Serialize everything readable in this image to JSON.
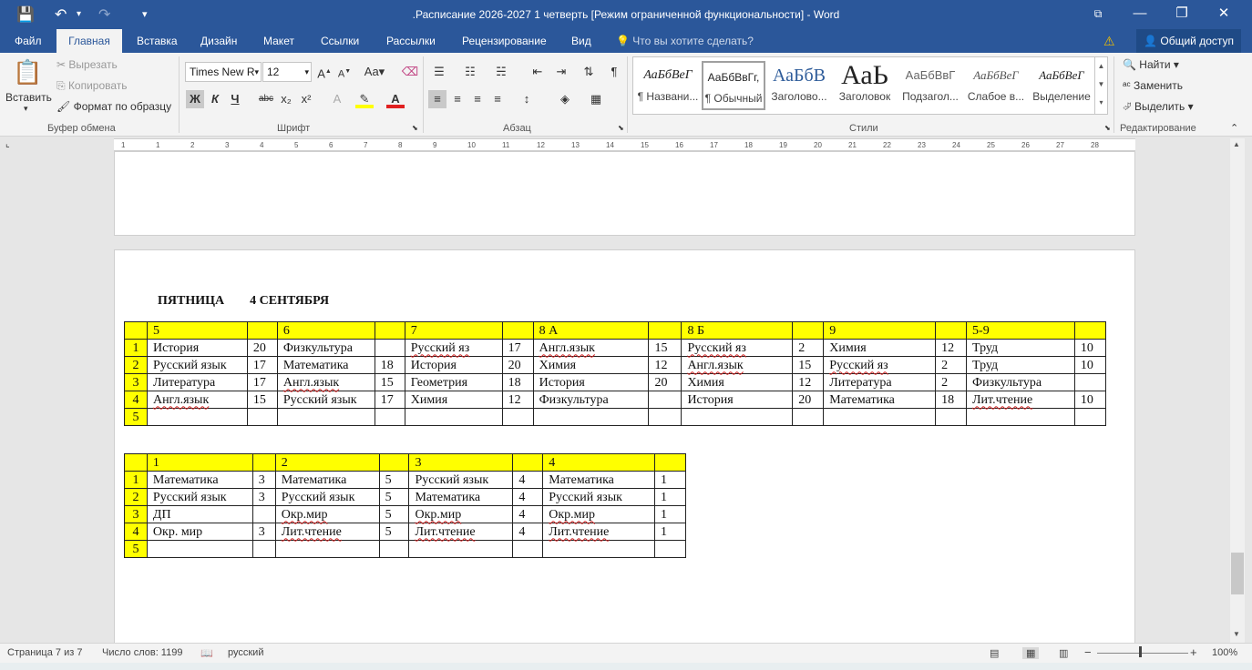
{
  "window": {
    "title": ".Расписание 2026-2027 1 четверть [Режим ограниченной функциональности] - Word",
    "minimize": "—",
    "restore": "❐",
    "close": "✕",
    "ribbon_display": "⧉"
  },
  "tabs": [
    {
      "label": "Файл",
      "active": false
    },
    {
      "label": "Главная",
      "active": true
    },
    {
      "label": "Вставка",
      "active": false
    },
    {
      "label": "Дизайн",
      "active": false
    },
    {
      "label": "Макет",
      "active": false
    },
    {
      "label": "Ссылки",
      "active": false
    },
    {
      "label": "Рассылки",
      "active": false
    },
    {
      "label": "Рецензирование",
      "active": false
    },
    {
      "label": "Вид",
      "active": false
    }
  ],
  "tell_me": "Что вы хотите сделать?",
  "share": "Общий доступ",
  "clipboard": {
    "paste": "Вставить",
    "cut": "Вырезать",
    "copy": "Копировать",
    "format_painter": "Формат по образцу",
    "label": "Буфер обмена"
  },
  "font": {
    "name": "Times New R",
    "size": "12",
    "label": "Шрифт",
    "bold": "Ж",
    "italic": "К",
    "underline": "Ч",
    "strike": "abc",
    "subscript": "x₂",
    "superscript": "x²"
  },
  "paragraph": {
    "label": "Абзац"
  },
  "styles": {
    "label": "Стили",
    "items": [
      {
        "sample": "АаБбВеГ",
        "name": "¶ Названи...",
        "selected": false
      },
      {
        "sample": "АаБбВвГг,",
        "name": "¶ Обычный",
        "selected": true
      },
      {
        "sample": "АаБбВ",
        "name": "Заголово...",
        "selected": false
      },
      {
        "sample": "АаЬ",
        "name": "Заголовок",
        "selected": false
      },
      {
        "sample": "АаБбВвГ",
        "name": "Подзагол...",
        "selected": false
      },
      {
        "sample": "АаБбВеГ",
        "name": "Слабое в...",
        "selected": false
      },
      {
        "sample": "АаБбВеГ",
        "name": "Выделение",
        "selected": false
      }
    ]
  },
  "editing": {
    "label": "Редактирование",
    "find": "Найти",
    "replace": "Заменить",
    "select": "Выделить"
  },
  "ruler_ticks": [
    "1",
    "1",
    "2",
    "3",
    "4",
    "5",
    "6",
    "7",
    "8",
    "9",
    "10",
    "11",
    "12",
    "13",
    "14",
    "15",
    "16",
    "17",
    "18",
    "19",
    "20",
    "21",
    "22",
    "23",
    "24",
    "25",
    "26",
    "27",
    "28"
  ],
  "document": {
    "heading": "ПЯТНИЦА        4 СЕНТЯБРЯ",
    "table1": {
      "header": [
        "",
        "5",
        "",
        "6",
        "",
        "7",
        "",
        "8 А",
        "",
        "8 Б",
        "",
        "9",
        "",
        "5-9",
        ""
      ],
      "rows": [
        [
          "1",
          "История",
          "20",
          "Физкультура",
          "",
          "Русский яз",
          "17",
          "Англ.язык",
          "15",
          "Русский яз",
          "2",
          "Химия",
          "12",
          "Труд",
          "10"
        ],
        [
          "2",
          "Русский язык",
          "17",
          "Математика",
          "18",
          "История",
          "20",
          "Химия",
          "12",
          "Англ.язык",
          "15",
          "Русский яз",
          "2",
          "Труд",
          "10"
        ],
        [
          "3",
          "Литература",
          "17",
          "Англ.язык",
          "15",
          "Геометрия",
          "18",
          "История",
          "20",
          "Химия",
          "12",
          "Литература",
          "2",
          "Физкультура",
          ""
        ],
        [
          "4",
          "Англ.язык",
          "15",
          "Русский язык",
          "17",
          "Химия",
          "12",
          "Физкультура",
          "",
          "История",
          "20",
          "Математика",
          "18",
          "Лит.чтение",
          "10"
        ],
        [
          "5",
          "",
          "",
          "",
          "",
          "",
          "",
          "",
          "",
          "",
          "",
          "",
          "",
          "",
          ""
        ]
      ]
    },
    "table2": {
      "header": [
        "",
        "1",
        "",
        "2",
        "",
        "3",
        "",
        "4",
        ""
      ],
      "rows": [
        [
          "1",
          "Математика",
          "3",
          "Математика",
          "5",
          "Русский язык",
          "4",
          "Математика",
          "1"
        ],
        [
          "2",
          "Русский язык",
          "3",
          "Русский язык",
          "5",
          "Математика",
          "4",
          "Русский язык",
          "1"
        ],
        [
          "3",
          "ДП",
          "",
          "Окр.мир",
          "5",
          "Окр.мир",
          "4",
          "Окр.мир",
          "1"
        ],
        [
          "4",
          "Окр. мир",
          "3",
          "Лит.чтение",
          "5",
          "Лит.чтение",
          "4",
          "Лит.чтение",
          "1"
        ],
        [
          "5",
          "",
          "",
          "",
          "",
          "",
          "",
          "",
          ""
        ]
      ]
    }
  },
  "status": {
    "page": "Страница 7 из 7",
    "words": "Число слов: 1199",
    "language": "русский",
    "zoom": "100%",
    "zoom_minus": "−",
    "zoom_plus": "+"
  }
}
